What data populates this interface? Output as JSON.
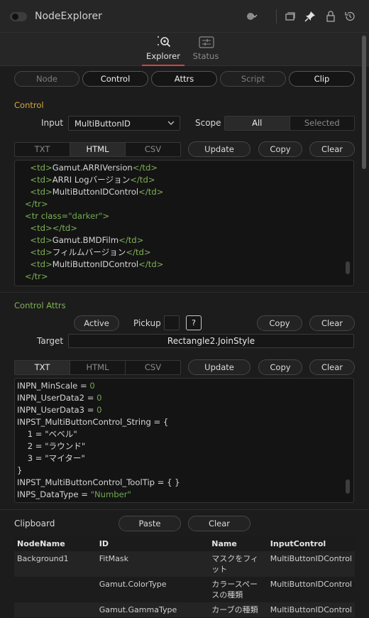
{
  "window": {
    "title": "NodeExplorer"
  },
  "tabs": [
    {
      "label": "Explorer",
      "icon": "explorer-icon"
    },
    {
      "label": "Status",
      "icon": "sliders-icon"
    }
  ],
  "mode_buttons": [
    "Node",
    "Control",
    "Attrs",
    "Script",
    "Clip"
  ],
  "control": {
    "section": "Control",
    "input_label": "Input",
    "input_value": "MultiButtonID",
    "scope_label": "Scope",
    "scope_options": [
      "All",
      "Selected"
    ],
    "formats": [
      "TXT",
      "HTML",
      "CSV"
    ],
    "update": "Update",
    "copy": "Copy",
    "clear": "Clear",
    "code_lines": [
      [
        "  <td>",
        "Gamut.ARRIVersion",
        "</td>"
      ],
      [
        "  <td>",
        "ARRI Logバージョン",
        "</td>"
      ],
      [
        "  <td>",
        "MultiButtonIDControl",
        "</td>"
      ],
      [
        "</tr>",
        "",
        ""
      ],
      [
        "<tr class=",
        "\"darker\"",
        ">"
      ],
      [
        "  <td></td>",
        "",
        ""
      ],
      [
        "  <td>",
        "Gamut.BMDFilm",
        "</td>"
      ],
      [
        "  <td>",
        "フィルムバージョン",
        "</td>"
      ],
      [
        "  <td>",
        "MultiButtonIDControl",
        "</td>"
      ],
      [
        "</tr>",
        "",
        ""
      ]
    ]
  },
  "attrs": {
    "section": "Control Attrs",
    "active": "Active",
    "pickup": "Pickup",
    "help": "?",
    "copy": "Copy",
    "clear": "Clear",
    "target_label": "Target",
    "target_value": "Rectangle2.JoinStyle",
    "formats": [
      "TXT",
      "HTML",
      "CSV"
    ],
    "update": "Update",
    "code_lines": [
      [
        "INPN_MinScale",
        " = ",
        "0"
      ],
      [
        "INPN_UserData2",
        " = ",
        "0"
      ],
      [
        "INPN_UserData3",
        " = ",
        "0"
      ],
      [
        "INPST_MultiButtonControl_String",
        " = {",
        ""
      ],
      [
        "    1 = ",
        "\"ベベル\"",
        ""
      ],
      [
        "    2 = ",
        "\"ラウンド\"",
        ""
      ],
      [
        "    3 = ",
        "\"マイター\"",
        ""
      ],
      [
        "}",
        "",
        ""
      ],
      [
        "INPST_MultiButtonControl_ToolTip",
        " = { }",
        ""
      ],
      [
        "INPS_DataType",
        " = ",
        "\"Number\""
      ]
    ]
  },
  "clipboard": {
    "label": "Clipboard",
    "paste": "Paste",
    "clear": "Clear",
    "columns": [
      "NodeName",
      "ID",
      "Name",
      "InputControl"
    ],
    "rows": [
      [
        "Background1",
        "FitMask",
        "マスクをフィット",
        "MultiButtonIDControl"
      ],
      [
        "",
        "Gamut.ColorType",
        "カラースペースの種類",
        "MultiButtonIDControl"
      ],
      [
        "",
        "Gamut.GammaType",
        "カーブの種類",
        "MultiButtonIDControl"
      ]
    ]
  }
}
